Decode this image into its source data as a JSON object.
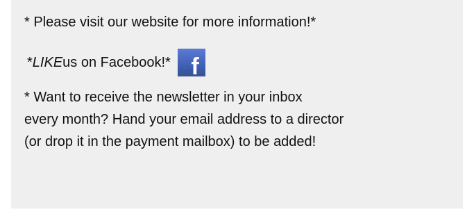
{
  "newsletter_notes": {
    "website_line": "* Please visit our website for more information!*",
    "facebook_prefix": "*",
    "facebook_like": "LIKE",
    "facebook_suffix": " us on Facebook!*",
    "facebook_icon": "facebook-icon",
    "facebook_icon_letter": "f",
    "inbox_line_1": "* Want to receive the newsletter in your inbox",
    "inbox_line_2": "every month? Hand your email address to a director",
    "inbox_line_3": "(or drop it in the payment mailbox) to be added!"
  },
  "colors": {
    "panel_background": "#efefef",
    "text": "#111111",
    "facebook_blue": "#3b5998"
  }
}
